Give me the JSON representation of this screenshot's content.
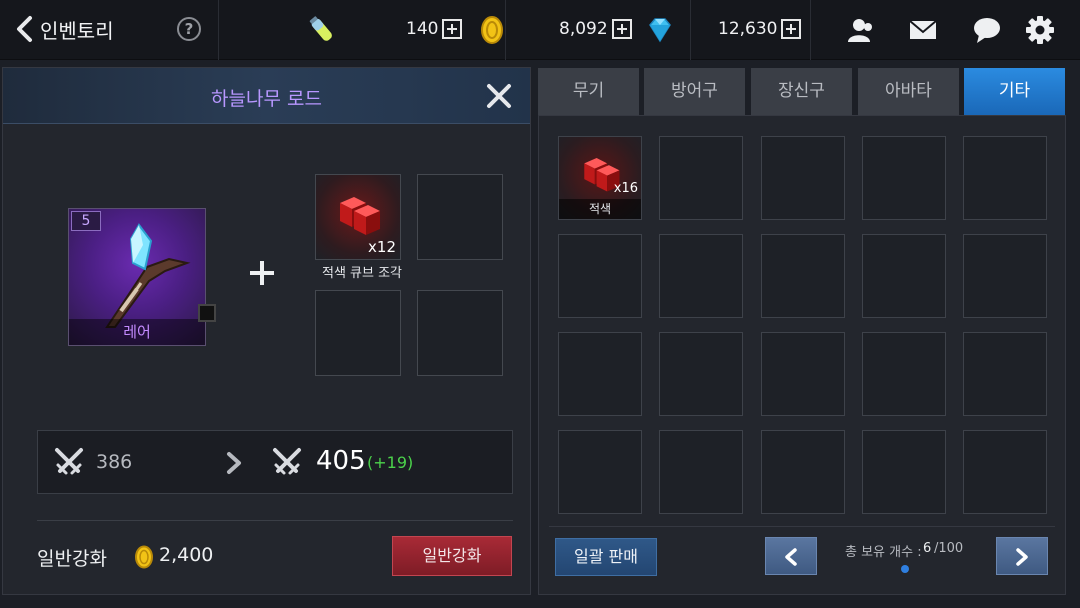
{
  "topbar": {
    "title": "인벤토리",
    "help_label": "?",
    "stamina": "140",
    "gold": "8,092",
    "gems": "12,630"
  },
  "enhance_panel": {
    "item_name": "하늘나무 로드",
    "item_level": "5",
    "item_rarity": "레어",
    "material_qty": "x12",
    "material_name": "적색 큐브 조각",
    "stat_current": "386",
    "stat_next": "405",
    "stat_bonus": "(+19)",
    "enhance_label": "일반강화",
    "enhance_cost": "2,400",
    "enhance_button": "일반강화"
  },
  "tabs": [
    {
      "label": "무기"
    },
    {
      "label": "방어구"
    },
    {
      "label": "장신구"
    },
    {
      "label": "아바타"
    },
    {
      "label": "기타"
    }
  ],
  "active_tab": "기타",
  "inventory": {
    "item_qty": "x16",
    "item_name": "적색",
    "sell_button": "일괄 판매",
    "count_label": "총 보유 개수 :",
    "count_value": "6",
    "count_max": "/100"
  },
  "colors": {
    "accent_blue": "#1a68b8",
    "rarity_purple": "#c48bff",
    "bonus_green": "#4bd24b",
    "enhance_red": "#a82a36",
    "gold": "#f2c316"
  }
}
